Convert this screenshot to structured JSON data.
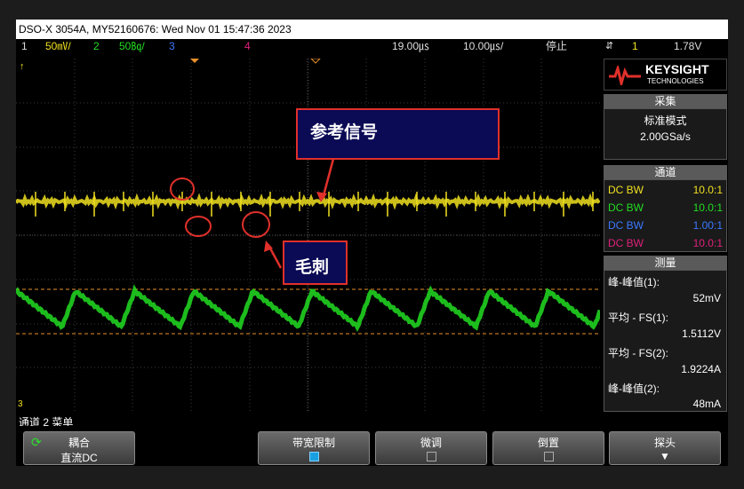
{
  "title_bar": "DSO-X 3054A, MY52160676: Wed Nov 01 15:47:36 2023",
  "status": {
    "ch1_num": "1",
    "ch1_scale": "50㎷/",
    "ch2_num": "2",
    "ch2_scale": "50㏃/",
    "ch3_num": "3",
    "ch4_num": "4",
    "time_delay": "19.00㎲",
    "time_scale": "10.00㎲/",
    "run_state": "停止",
    "trig_icon": "trigger-edge-icon",
    "trig_source": "1",
    "trig_level": "1.78V"
  },
  "logo": {
    "name": "KEYSIGHT",
    "sub": "TECHNOLOGIES"
  },
  "acquire": {
    "header": "采集",
    "mode": "标准模式",
    "rate": "2.00GSa/s"
  },
  "channels": {
    "header": "通道",
    "rows": [
      {
        "coupling": "DC BW",
        "probe": "10.0:1",
        "color": "#f0e020"
      },
      {
        "coupling": "DC BW",
        "probe": "10.0:1",
        "color": "#22dd22"
      },
      {
        "coupling": "DC BW",
        "probe": "1.00:1",
        "color": "#3a78ff"
      },
      {
        "coupling": "DC BW",
        "probe": "10.0:1",
        "color": "#e0207a"
      }
    ]
  },
  "measure": {
    "header": "测量",
    "items": [
      {
        "label": "峰-峰值(1):",
        "value": "52mV"
      },
      {
        "label": "平均 - FS(1):",
        "value": "1.5112V"
      },
      {
        "label": "平均 - FS(2):",
        "value": "1.9224A"
      },
      {
        "label": "峰-峰值(2):",
        "value": "48mA"
      }
    ]
  },
  "menu_title": "通道 2 菜单",
  "softkeys": {
    "coupling_label": "耦合",
    "coupling_value": "直流DC",
    "bw_limit_label": "带宽限制",
    "fine_label": "微调",
    "invert_label": "倒置",
    "probe_label": "探头"
  },
  "annotations": {
    "reference": "参考信号",
    "spike": "毛刺"
  },
  "colors": {
    "ch1": "#f0e020",
    "ch2": "#22dd22",
    "ch3": "#3a78ff",
    "ch4": "#e0207a",
    "callout_border": "#e0302a"
  }
}
